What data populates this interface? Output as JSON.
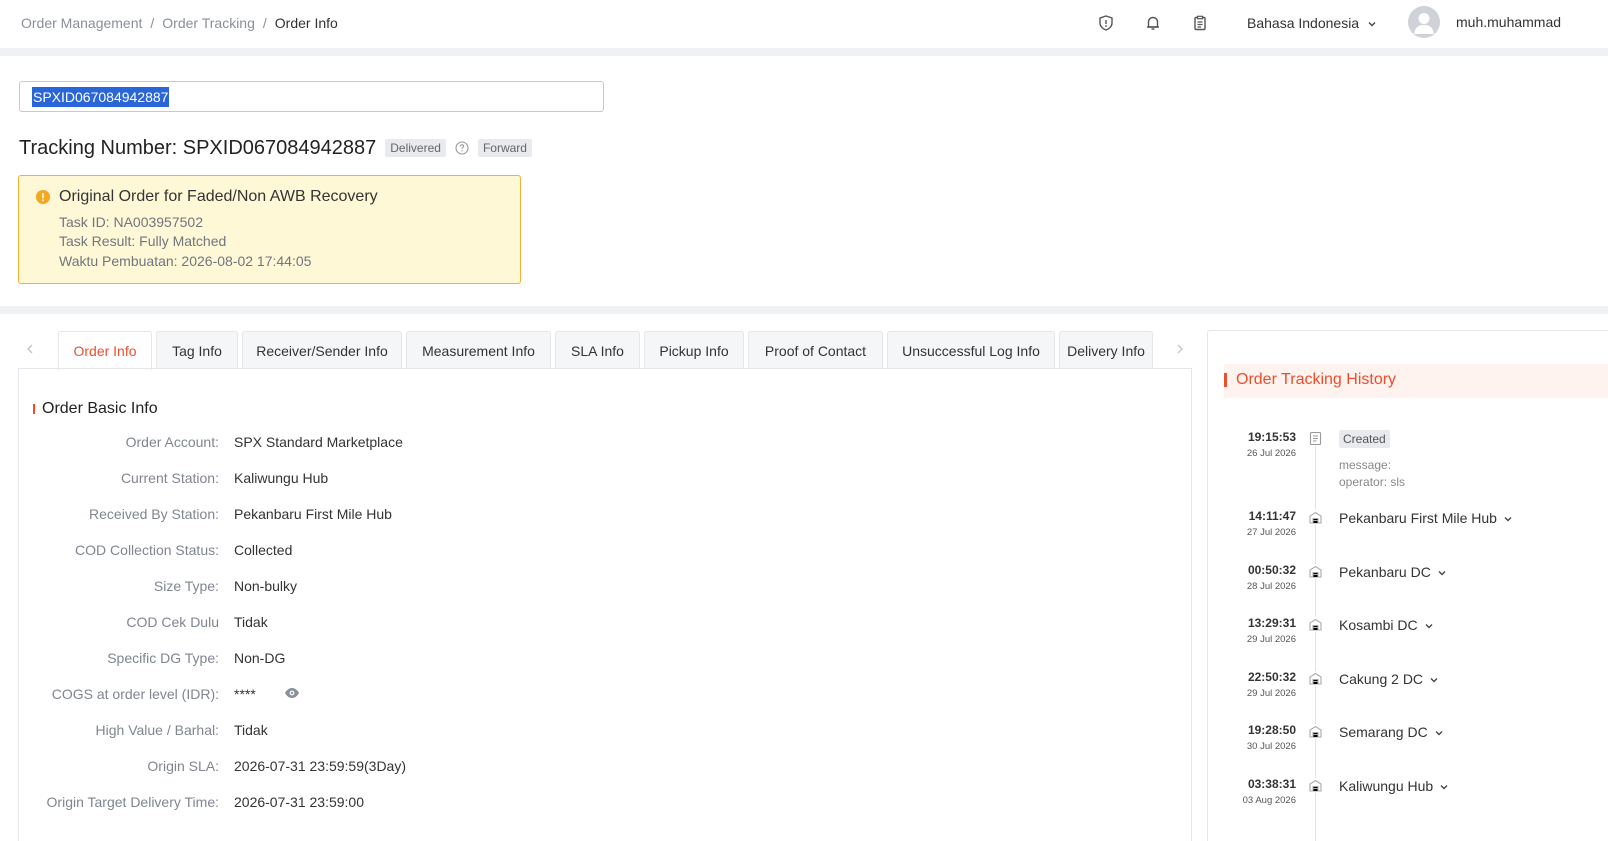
{
  "breadcrumb": [
    "Order Management",
    "Order Tracking",
    "Order Info"
  ],
  "header": {
    "language": "Bahasa Indonesia",
    "username": "muh.muhammad",
    "icons": [
      "shield-icon",
      "bell-icon",
      "clipboard-icon",
      "chevron-down-icon",
      "avatar-icon"
    ]
  },
  "search": {
    "value": "SPXID067084942887"
  },
  "tracking": {
    "title": "Tracking Number: SPXID067084942887",
    "status": "Delivered",
    "direction": "Forward"
  },
  "alert": {
    "title": "Original Order for Faded/Non AWB Recovery",
    "lines": [
      "Task ID: NA003957502",
      "Task Result: Fully Matched",
      "Waktu Pembuatan: 2026-08-02 17:44:05"
    ]
  },
  "tabs": [
    "Order Info",
    "Tag Info",
    "Receiver/Sender Info",
    "Measurement Info",
    "SLA Info",
    "Pickup Info",
    "Proof of Contact",
    "Unsuccessful Log Info",
    "Delivery Info"
  ],
  "basic_info": {
    "title": "Order Basic Info",
    "rows": [
      {
        "label": "Order Account:",
        "value": "SPX Standard Marketplace"
      },
      {
        "label": "Current Station:",
        "value": "Kaliwungu Hub"
      },
      {
        "label": "Received By Station:",
        "value": "Pekanbaru First Mile Hub"
      },
      {
        "label": "COD Collection Status:",
        "value": "Collected"
      },
      {
        "label": "Size Type:",
        "value": "Non-bulky"
      },
      {
        "label": "COD Cek Dulu",
        "value": "Tidak"
      },
      {
        "label": "Specific DG Type:",
        "value": "Non-DG"
      },
      {
        "label": "COGS at order level (IDR):",
        "value": "****"
      },
      {
        "label": "High Value / Barhal:",
        "value": "Tidak"
      },
      {
        "label": "Origin SLA:",
        "value": "2026-07-31 23:59:59(3Day)"
      },
      {
        "label": "Origin Target Delivery Time:",
        "value": "2026-07-31 23:59:00"
      }
    ]
  },
  "history": {
    "title": "Order Tracking History",
    "events": [
      {
        "time": "19:15:53",
        "date": "26 Jul 2026",
        "badge": "Created",
        "message": "message:",
        "operator": "operator: sls"
      },
      {
        "time": "14:11:47",
        "date": "27 Jul 2026",
        "location": "Pekanbaru First Mile Hub"
      },
      {
        "time": "00:50:32",
        "date": "28 Jul 2026",
        "location": "Pekanbaru DC"
      },
      {
        "time": "13:29:31",
        "date": "29 Jul 2026",
        "location": "Kosambi DC"
      },
      {
        "time": "22:50:32",
        "date": "29 Jul 2026",
        "location": "Cakung 2 DC"
      },
      {
        "time": "19:28:50",
        "date": "30 Jul 2026",
        "location": "Semarang DC"
      },
      {
        "time": "03:38:31",
        "date": "03 Aug 2026",
        "location": "Kaliwungu Hub"
      }
    ]
  },
  "colors": {
    "accent": "#ee4d2d",
    "warning_bg": "#fff8d6",
    "warning_border": "#f3b13a",
    "selection": "#2a66d8"
  }
}
